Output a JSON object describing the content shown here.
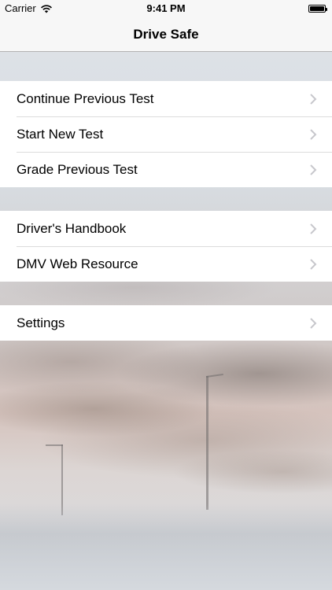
{
  "status_bar": {
    "carrier": "Carrier",
    "time": "9:41 PM"
  },
  "nav": {
    "title": "Drive Safe"
  },
  "groups": [
    {
      "items": [
        {
          "label": "Continue Previous Test",
          "icon": "chevron-right-icon"
        },
        {
          "label": "Start New Test",
          "icon": "chevron-right-icon"
        },
        {
          "label": "Grade Previous Test",
          "icon": "chevron-right-icon"
        }
      ]
    },
    {
      "items": [
        {
          "label": "Driver's Handbook",
          "icon": "chevron-right-icon"
        },
        {
          "label": "DMV Web Resource",
          "icon": "chevron-right-icon"
        }
      ]
    },
    {
      "items": [
        {
          "label": "Settings",
          "icon": "chevron-right-icon"
        }
      ]
    }
  ],
  "colors": {
    "bar_background": "#f7f7f7",
    "cell_background": "#ffffff",
    "chevron": "#c7c7cc",
    "separator": "#dcdcdc"
  }
}
